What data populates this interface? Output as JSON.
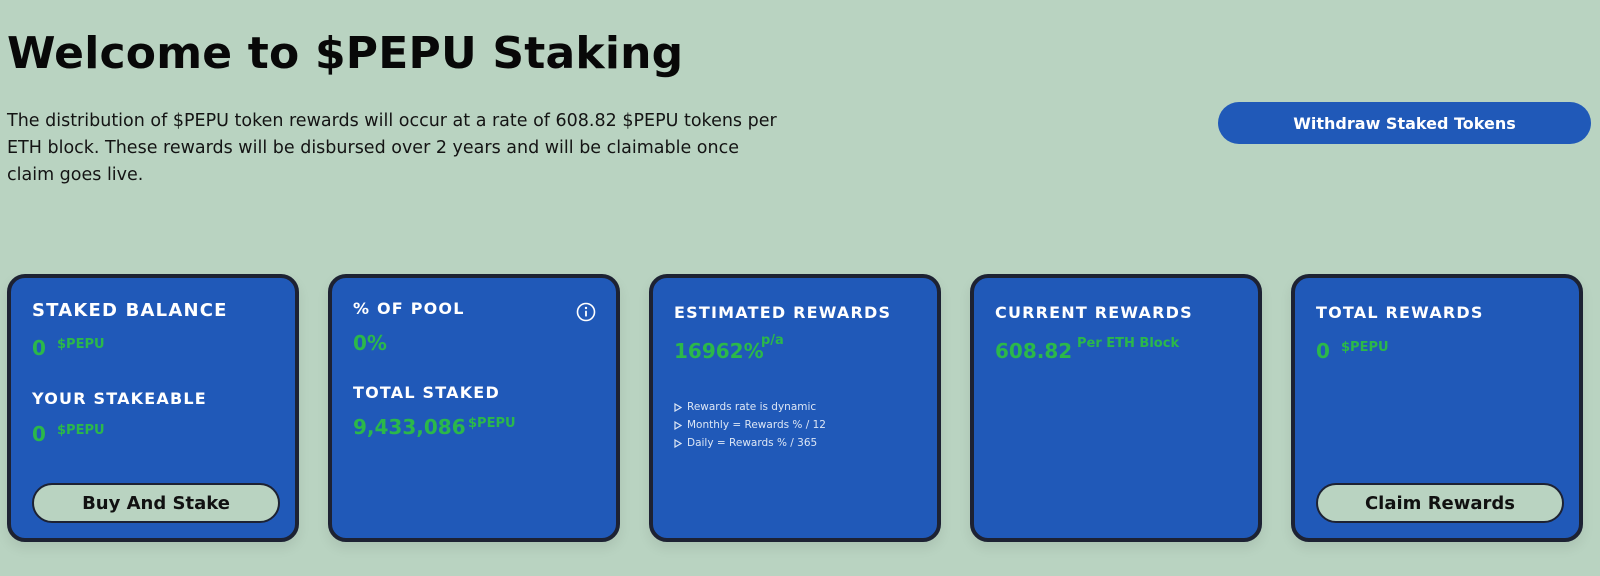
{
  "header": {
    "title": "Welcome to $PEPU Staking",
    "description": "The distribution of $PEPU token rewards will occur at a rate of 608.82 $PEPU tokens per ETH block. These rewards will be disbursed over 2 years and will be claimable once claim goes live.",
    "withdraw_label": "Withdraw Staked Tokens"
  },
  "cards": {
    "staked": {
      "label": "STAKED BALANCE",
      "value": "0",
      "unit": "$PEPU",
      "stakeable_label": "YOUR STAKEABLE",
      "stakeable_value": "0",
      "stakeable_unit": "$PEPU",
      "button_label": "Buy And Stake"
    },
    "pool": {
      "label": "% OF POOL",
      "value": "0%",
      "total_label": "TOTAL STAKED",
      "total_value": "9,433,086",
      "total_unit": "$PEPU",
      "icon": "info-icon"
    },
    "estimated": {
      "label": "ESTIMATED REWARDS",
      "value": "16962%",
      "unit": "p/a",
      "notes": [
        "Rewards rate is dynamic",
        "Monthly = Rewards % / 12",
        "Daily = Rewards % / 365"
      ]
    },
    "current": {
      "label": "CURRENT REWARDS",
      "value": "608.82",
      "unit": "Per ETH Block"
    },
    "total": {
      "label": "TOTAL REWARDS",
      "value": "0",
      "unit": "$PEPU",
      "button_label": "Claim Rewards"
    }
  },
  "colors": {
    "background": "#b9d3c1",
    "card": "#2059b8",
    "card_border": "#1d2233",
    "accent_green": "#2bb84a",
    "button_blue": "#2059b8"
  }
}
